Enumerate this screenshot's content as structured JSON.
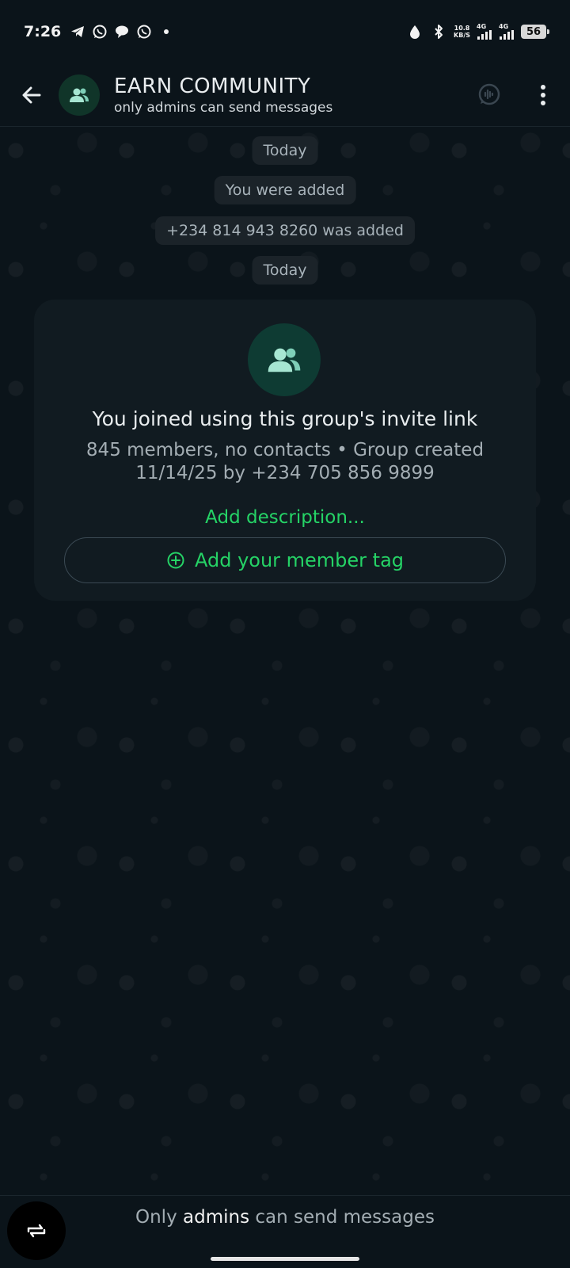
{
  "status_bar": {
    "time": "7:26",
    "net_speed_value": "10.8",
    "net_speed_unit": "KB/S",
    "signal1_label": "4G",
    "signal2_label": "4G",
    "battery": "56",
    "notification_icons": [
      "telegram-icon",
      "whatsapp-icon",
      "chat-bubble-icon",
      "whatsapp-icon",
      "dot-icon"
    ]
  },
  "header": {
    "title": "EARN COMMUNITY",
    "subtitle": "only admins can send messages"
  },
  "chat": {
    "date_chip_1": "Today",
    "system_msg_1": "You were added",
    "system_msg_2": "+234 814 943 8260 was added",
    "date_chip_2": "Today"
  },
  "group_card": {
    "title": "You joined using this group's invite link",
    "meta_line_1": "845 members, no contacts • Group created",
    "meta_line_2": "11/14/25 by +234 705 856 9899",
    "description_link": "Add description...",
    "member_tag_button": "Add your member tag"
  },
  "bottom": {
    "notice_prefix": "Only",
    "notice_strong": "admins",
    "notice_suffix": "can send messages"
  },
  "colors": {
    "background": "#0b141a",
    "card": "#111b21",
    "accent_green": "#25d366",
    "chip": "#1b2329"
  }
}
